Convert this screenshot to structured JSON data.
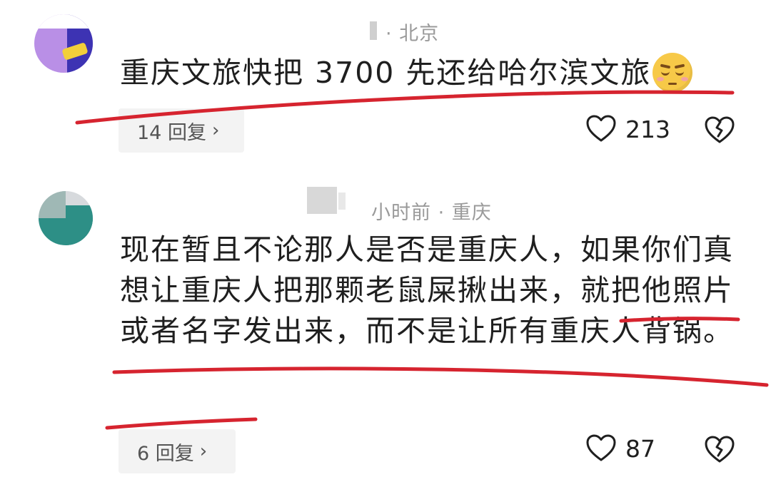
{
  "comments": [
    {
      "meta": "· 北京",
      "text": "重庆文旅快把 3700 先还给哈尔滨文旅",
      "emoji": "relieved-face-emoji",
      "replies": "14 回复",
      "likes": "213"
    },
    {
      "meta": "小时前 · 重庆",
      "text": "现在暂且不论那人是否是重庆人，如果你们真想让重庆人把那颗老鼠屎揪出来，就把他照片或者名字发出来，而不是让所有重庆人背锅。",
      "replies": "6 回复",
      "likes": "87"
    }
  ],
  "icons": {
    "like": "heart-outline-icon",
    "dislike": "broken-heart-icon",
    "chevron": "chevron-right-icon"
  },
  "colors": {
    "annotation": "#d6242f",
    "text": "#1f1f1f",
    "meta": "#9a9a9a",
    "chip_bg": "#f3f3f3"
  }
}
